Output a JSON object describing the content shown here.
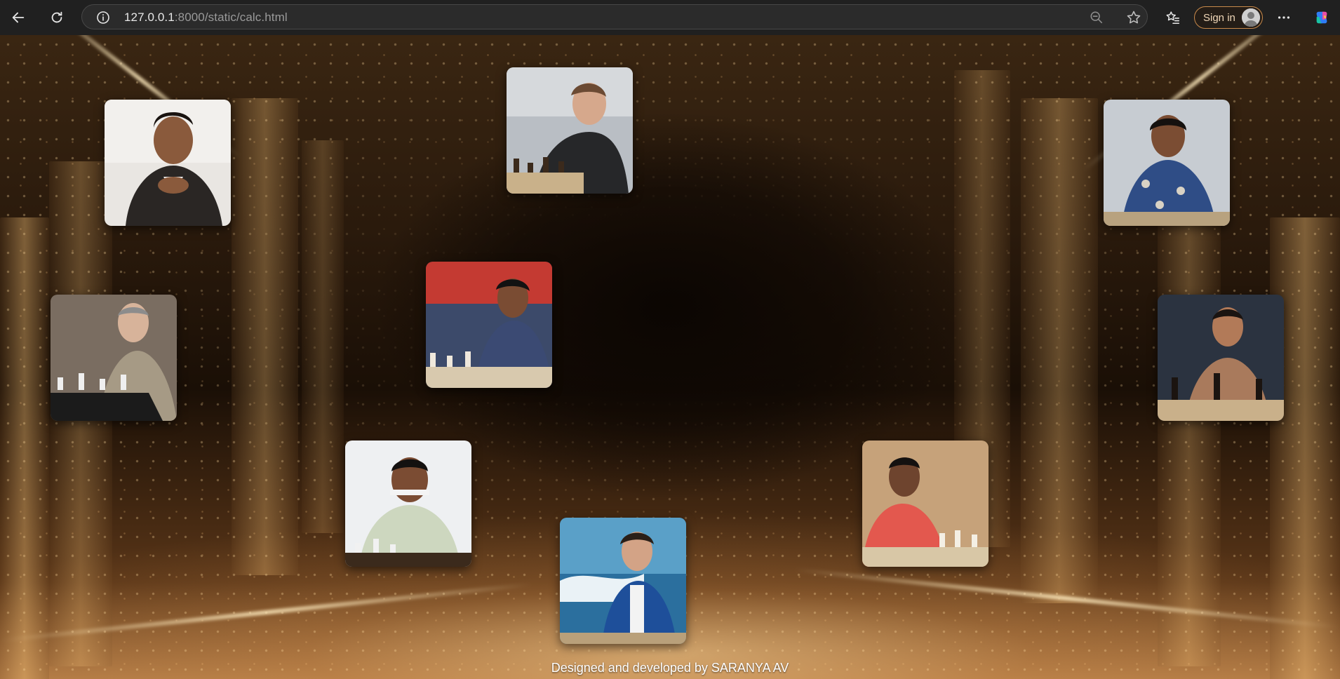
{
  "browser": {
    "url_host": "127.0.0.1",
    "url_rest": ":8000/static/calc.html",
    "signin_label": "Sign in",
    "icons": [
      "back-arrow-icon",
      "reload-icon",
      "site-info-icon",
      "zoom-out-icon",
      "favorite-star-icon",
      "favorites-list-icon",
      "profile-avatar-icon",
      "more-options-icon",
      "copilot-icon"
    ]
  },
  "page": {
    "cards": [
      {
        "name": "player-photo-1",
        "desc": "man in dark suit, hands clasped"
      },
      {
        "name": "player-photo-2",
        "desc": "man in black jacket at chessboard"
      },
      {
        "name": "player-photo-3",
        "desc": "boy in blue shirt at chessboard"
      },
      {
        "name": "player-photo-4",
        "desc": "older man in grey suit playing chess"
      },
      {
        "name": "player-photo-5",
        "desc": "young man thinking over board"
      },
      {
        "name": "player-photo-6",
        "desc": "woman with chess pieces"
      },
      {
        "name": "player-photo-7",
        "desc": "smiling man in checked shirt"
      },
      {
        "name": "player-photo-8",
        "desc": "young man in blue blazer"
      },
      {
        "name": "player-photo-9",
        "desc": "woman in red top at chessboard"
      }
    ],
    "footer": "Designed and developed by SARANYA AV"
  },
  "colors": {
    "chrome_bg": "#202020",
    "accent_signin": "#c98a4b",
    "gold": "#d9a45c"
  }
}
